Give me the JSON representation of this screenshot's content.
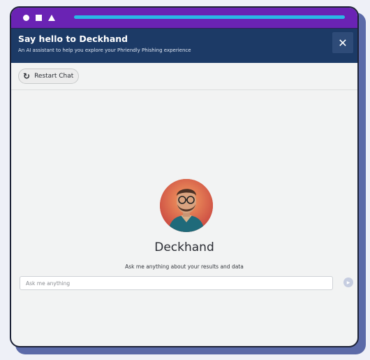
{
  "window": {
    "controls": [
      "circle",
      "square",
      "triangle"
    ],
    "accent": "#6a23b4",
    "url_bar_color": "#2ab8e6"
  },
  "header": {
    "title": "Say hello to Deckhand",
    "subtitle": "An AI assistant to help you explore your Phriendly Phishing experience",
    "close_icon": "close-icon",
    "close_label": "✕",
    "background": "#1c3a66"
  },
  "toolbar": {
    "restart_label": "Restart Chat",
    "restart_icon": "refresh-icon"
  },
  "assistant": {
    "name": "Deckhand",
    "tagline": "Ask me anything about your results and data",
    "avatar_icon": "avatar"
  },
  "input": {
    "placeholder": "Ask me anything",
    "value": "",
    "send_icon": "send-icon"
  }
}
